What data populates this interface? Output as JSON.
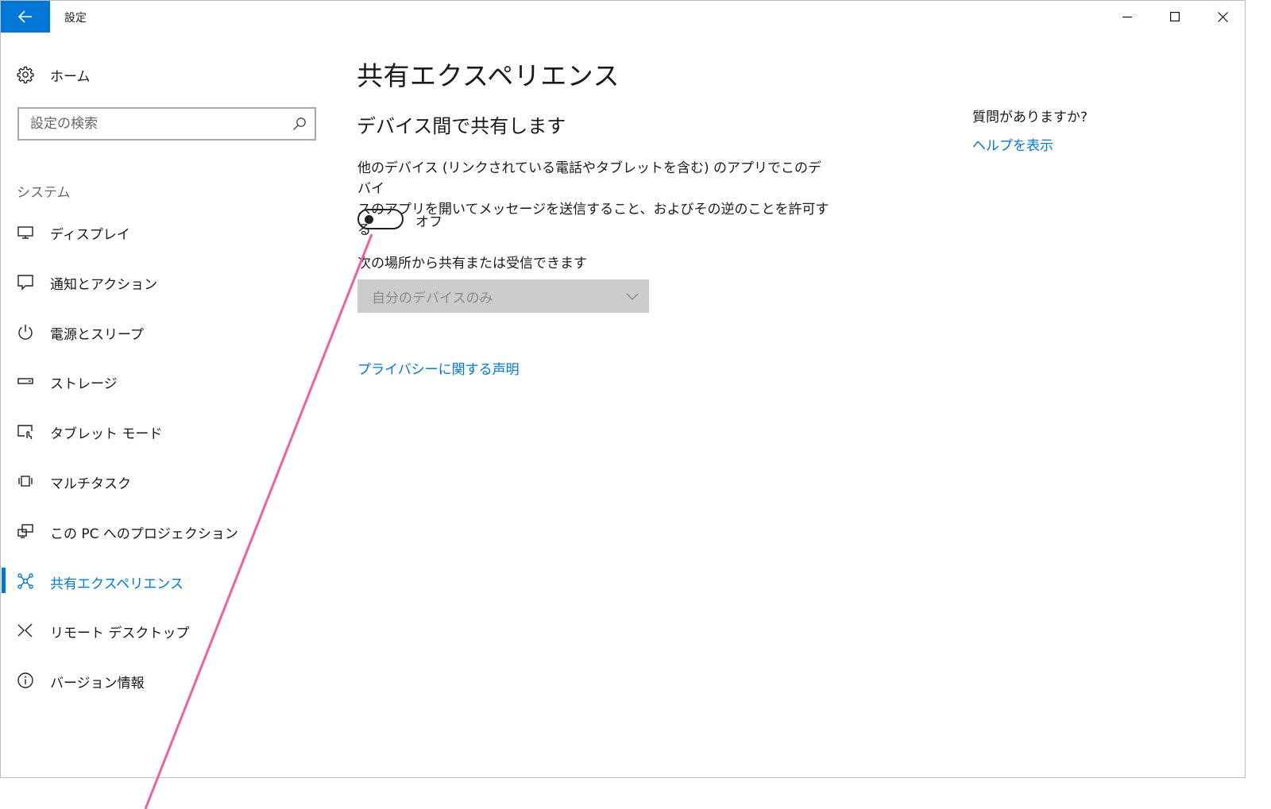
{
  "window": {
    "title": "設定"
  },
  "sidebar": {
    "home_label": "ホーム",
    "search_placeholder": "設定の検索",
    "section_label": "システム",
    "items": [
      {
        "label": "ディスプレイ",
        "icon": "monitor-icon"
      },
      {
        "label": "通知とアクション",
        "icon": "message-icon"
      },
      {
        "label": "電源とスリープ",
        "icon": "power-icon"
      },
      {
        "label": "ストレージ",
        "icon": "storage-icon"
      },
      {
        "label": "タブレット モード",
        "icon": "tablet-mode-icon"
      },
      {
        "label": "マルチタスク",
        "icon": "multitask-icon"
      },
      {
        "label": "この PC へのプロジェクション",
        "icon": "projection-icon"
      },
      {
        "label": "共有エクスペリエンス",
        "icon": "shared-experiences-icon",
        "active": true
      },
      {
        "label": "リモート デスクトップ",
        "icon": "remote-desktop-icon"
      },
      {
        "label": "バージョン情報",
        "icon": "info-icon"
      }
    ]
  },
  "main": {
    "title": "共有エクスペリエンス",
    "subtitle": "デバイス間で共有します",
    "description_line1": "他のデバイス (リンクされている電話やタブレットを含む) のアプリでこのデバイ",
    "description_line2": "スのアプリを開いてメッセージを送信すること、およびその逆のことを許可する",
    "toggle_state": "オフ",
    "share_from_label": "次の場所から共有または受信できます",
    "share_from_value": "自分のデバイスのみ",
    "privacy_link": "プライバシーに関する声明"
  },
  "help": {
    "question": "質問がありますか?",
    "link": "ヘルプを表示"
  },
  "colors": {
    "accent": "#0078d7",
    "annotation": "#f0609e"
  }
}
